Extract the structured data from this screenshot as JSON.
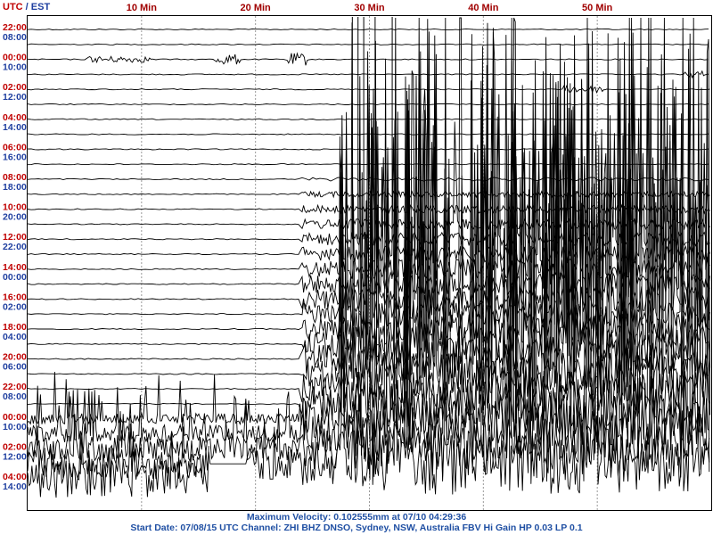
{
  "chart_data": {
    "type": "line",
    "subtype": "seismogram helicorder",
    "header": {
      "utc_label": "UTC",
      "separator": " / ",
      "local_label": "EST"
    },
    "x_ticks": [
      "10 Min",
      "20 Min",
      "30 Min",
      "40 Min",
      "50 Min"
    ],
    "x_tick_values": [
      10,
      20,
      30,
      40,
      50
    ],
    "xlim": [
      0,
      60
    ],
    "grid": true,
    "rows_utc_labels": [
      "22:00",
      "00:00",
      "02:00",
      "04:00",
      "06:00",
      "08:00",
      "10:00",
      "12:00",
      "14:00",
      "16:00",
      "18:00",
      "20:00",
      "22:00",
      "00:00",
      "02:00",
      "04:00"
    ],
    "rows_local_labels": [
      "08:00",
      "10:00",
      "12:00",
      "14:00",
      "16:00",
      "18:00",
      "20:00",
      "22:00",
      "00:00",
      "02:00",
      "04:00",
      "06:00",
      "08:00",
      "10:00",
      "12:00",
      "14:00"
    ],
    "line_count": 31,
    "activity": {
      "teleseismic_onset_minute": 24,
      "strong_arrival_minute": 28,
      "peak_minutes": [
        28.5,
        29,
        29.5,
        30.5,
        32
      ],
      "continuous_noise_from_line": 26,
      "data_gap_minutes": [
        16,
        19.5
      ]
    },
    "colors": {
      "utc": "#c00000",
      "local": "#1f3fa0",
      "trace": "#000000",
      "grid": "#999999",
      "footer": "#1f4fa3"
    }
  },
  "footer": {
    "max_velocity": "Maximum Velocity: 0.102555mm at 07/10 04:29:36",
    "start_info": "Start Date: 07/08/15 UTC Channel: ZHI  BHZ  DNSO, Sydney, NSW, Australia  FBV Hi Gain HP 0.03  LP 0.1"
  }
}
